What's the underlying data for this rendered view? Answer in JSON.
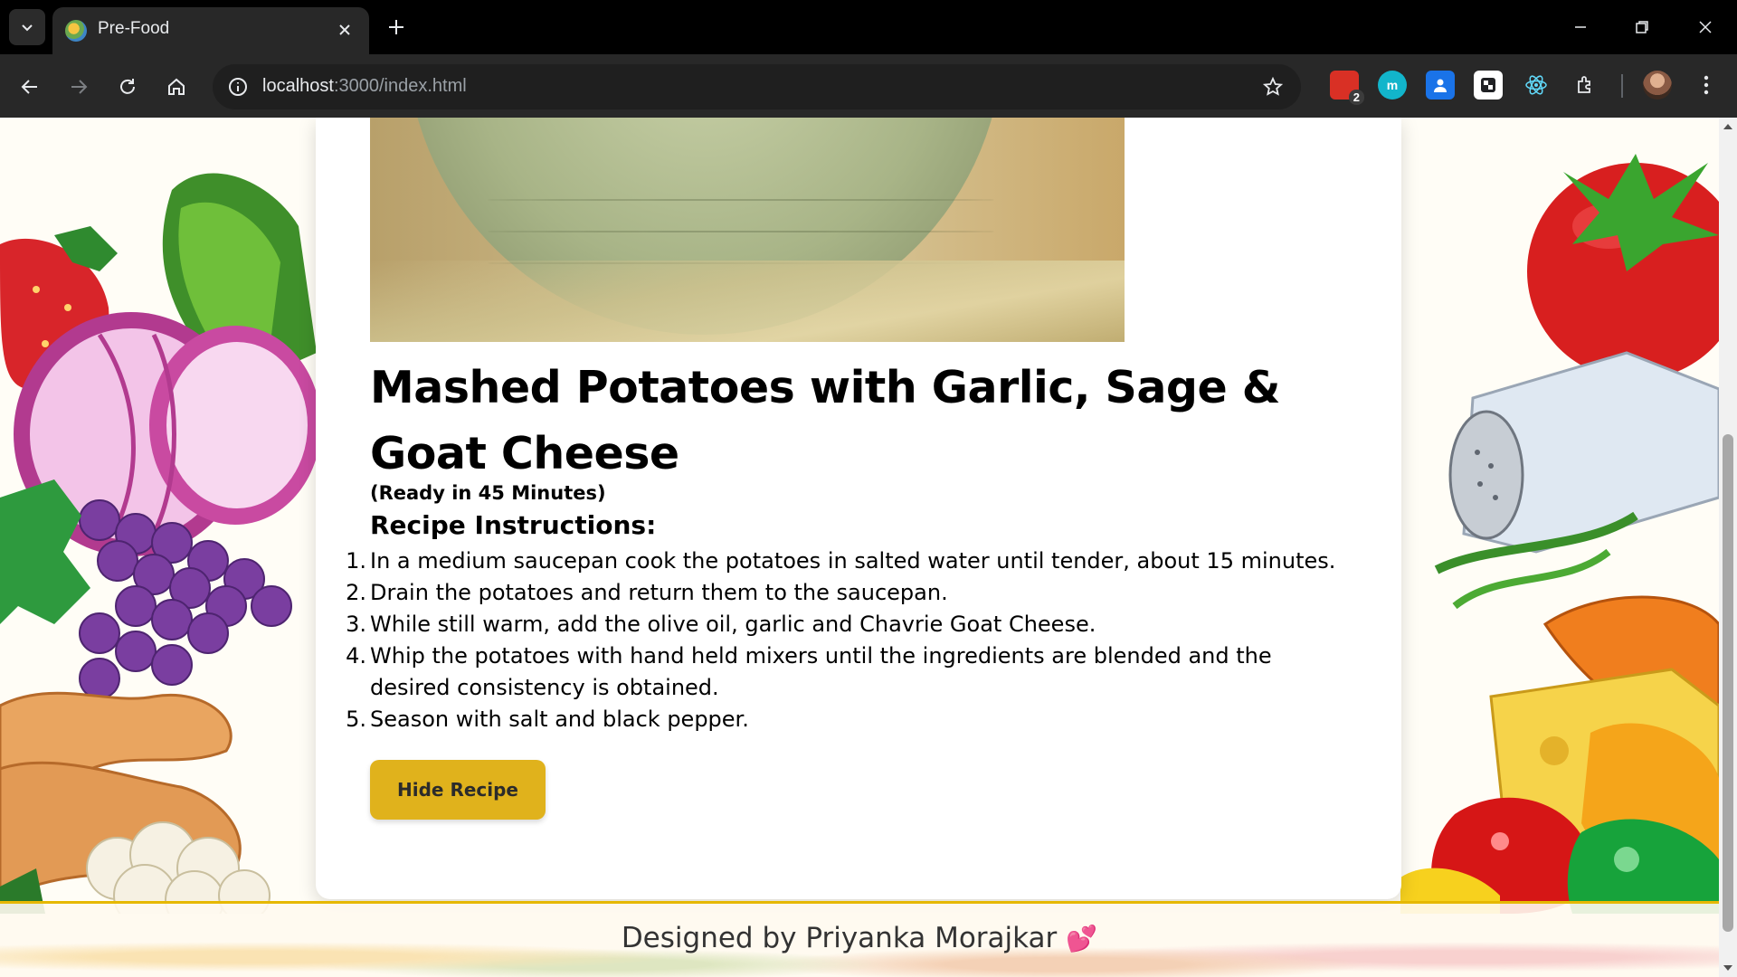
{
  "browser": {
    "tab_title": "Pre-Food",
    "url_host": "localhost",
    "url_rest": ":3000/index.html",
    "extensions": [
      {
        "name": "extension-red",
        "badge": "2",
        "color": "#d93025"
      },
      {
        "name": "extension-m",
        "label": "m",
        "color": "#12b5cb"
      },
      {
        "name": "extension-contacts",
        "color": "#1a73e8"
      },
      {
        "name": "extension-translate",
        "color": "#ffffff"
      },
      {
        "name": "extension-react",
        "color": "#61dafb"
      }
    ]
  },
  "recipe": {
    "title": "Mashed Potatoes with Garlic, Sage & Goat Cheese",
    "ready": "(Ready in 45 Minutes)",
    "instructions_heading": "Recipe Instructions:",
    "steps": [
      "In a medium saucepan cook the potatoes in salted water until tender, about 15 minutes.",
      "Drain the potatoes and return them to the saucepan.",
      "While still warm, add the olive oil, garlic and Chavrie Goat Cheese.",
      "Whip the potatoes with hand held mixers until the ingredients are blended and the desired consistency is obtained.",
      "Season with salt and black pepper."
    ],
    "hide_button_label": "Hide Recipe"
  },
  "footer": {
    "text": "Designed by Priyanka Morajkar",
    "heart": "💕"
  },
  "colors": {
    "accent": "#e0b21c",
    "footer_border": "#e6b800"
  }
}
